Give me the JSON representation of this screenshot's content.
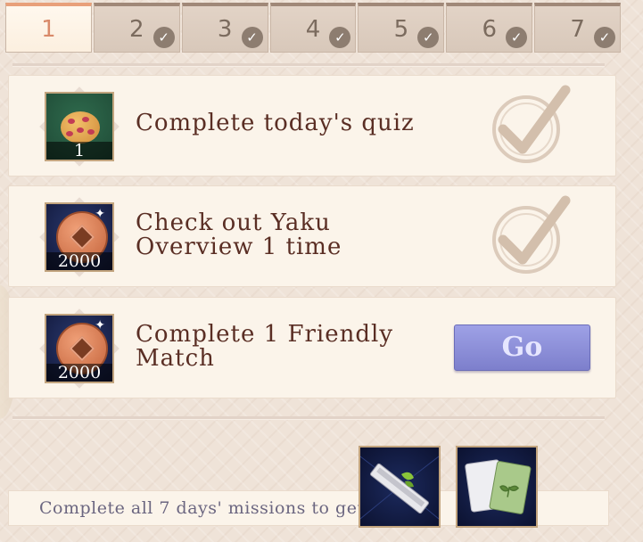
{
  "tabs": [
    {
      "label": "1",
      "active": true,
      "completed": false
    },
    {
      "label": "2",
      "active": false,
      "completed": true
    },
    {
      "label": "3",
      "active": false,
      "completed": true
    },
    {
      "label": "4",
      "active": false,
      "completed": true
    },
    {
      "label": "5",
      "active": false,
      "completed": true
    },
    {
      "label": "6",
      "active": false,
      "completed": true
    },
    {
      "label": "7",
      "active": false,
      "completed": true
    }
  ],
  "missions": [
    {
      "text": "Complete today's quiz",
      "reward_icon": "cookie-icon",
      "reward_count": "1",
      "status": "completed"
    },
    {
      "text": "Check out Yaku Overview 1 time",
      "reward_icon": "coin-icon",
      "reward_count": "2000",
      "status": "completed"
    },
    {
      "text": "Complete 1 Friendly Match",
      "reward_icon": "coin-icon",
      "reward_count": "2000",
      "status": "pending",
      "button_label": "Go"
    }
  ],
  "footer": {
    "text": "Complete all 7 days' missions to get:",
    "rewards": [
      {
        "icon": "tile-rack-icon"
      },
      {
        "icon": "card-pair-icon"
      }
    ]
  },
  "colors": {
    "accent_go": "#8c8fdc",
    "text_dark": "#5a2e24",
    "check_stamp": "#d9c7b6"
  }
}
